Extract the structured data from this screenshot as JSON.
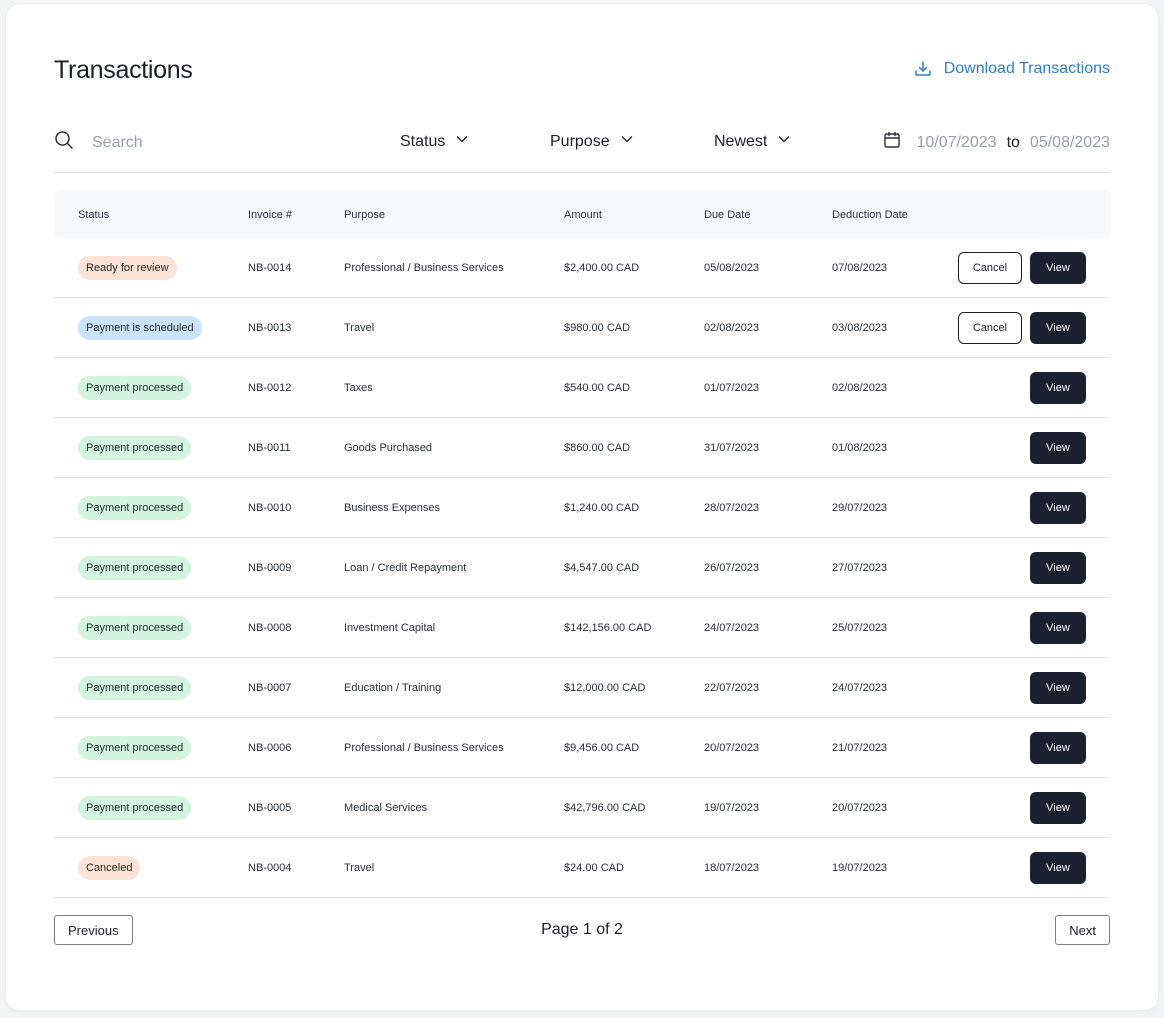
{
  "header": {
    "title": "Transactions",
    "download_label": "Download Transactions"
  },
  "filters": {
    "search_placeholder": "Search",
    "status_label": "Status",
    "purpose_label": "Purpose",
    "sort_label": "Newest",
    "date_from": "10/07/2023",
    "date_to_word": "to",
    "date_to": "05/08/2023"
  },
  "table": {
    "columns": [
      "Status",
      "Invoice #",
      "Purpose",
      "Amount",
      "Due Date",
      "Deduction Date"
    ],
    "rows": [
      {
        "status": "Ready for review",
        "invoice": "NB-0014",
        "purpose": "Professional / Business Services",
        "amount": "$2,400.00 CAD",
        "due": "05/08/2023",
        "deduction": "07/08/2023"
      },
      {
        "status": "Payment is scheduled",
        "invoice": "NB-0013",
        "purpose": "Travel",
        "amount": "$980.00 CAD",
        "due": "02/08/2023",
        "deduction": "03/08/2023"
      },
      {
        "status": "Payment processed",
        "invoice": "NB-0012",
        "purpose": "Taxes",
        "amount": "$540.00 CAD",
        "due": "01/07/2023",
        "deduction": "02/08/2023"
      },
      {
        "status": "Payment processed",
        "invoice": "NB-0011",
        "purpose": "Goods Purchased",
        "amount": "$860.00 CAD",
        "due": "31/07/2023",
        "deduction": "01/08/2023"
      },
      {
        "status": "Payment processed",
        "invoice": "NB-0010",
        "purpose": "Business Expenses",
        "amount": "$1,240.00 CAD",
        "due": "28/07/2023",
        "deduction": "29/07/2023"
      },
      {
        "status": "Payment processed",
        "invoice": "NB-0009",
        "purpose": "Loan / Credit Repayment",
        "amount": "$4,547.00 CAD",
        "due": "26/07/2023",
        "deduction": "27/07/2023"
      },
      {
        "status": "Payment processed",
        "invoice": "NB-0008",
        "purpose": "Investment Capital",
        "amount": "$142,156.00 CAD",
        "due": "24/07/2023",
        "deduction": "25/07/2023"
      },
      {
        "status": "Payment processed",
        "invoice": "NB-0007",
        "purpose": "Education / Training",
        "amount": "$12,000.00 CAD",
        "due": "22/07/2023",
        "deduction": "24/07/2023"
      },
      {
        "status": "Payment processed",
        "invoice": "NB-0006",
        "purpose": "Professional / Business Services",
        "amount": "$9,456.00 CAD",
        "due": "20/07/2023",
        "deduction": "21/07/2023"
      },
      {
        "status": "Payment processed",
        "invoice": "NB-0005",
        "purpose": "Medical Services",
        "amount": "$42,796.00 CAD",
        "due": "19/07/2023",
        "deduction": "20/07/2023"
      },
      {
        "status": "Canceled",
        "invoice": "NB-0004",
        "purpose": "Travel",
        "amount": "$24.00 CAD",
        "due": "18/07/2023",
        "deduction": "19/07/2023"
      }
    ],
    "view_label": "View",
    "cancel_label": "Cancel"
  },
  "pagination": {
    "previous_label": "Previous",
    "page_info": "Page 1 of 2",
    "next_label": "Next"
  },
  "colors": {
    "accent": "#2f80c8",
    "dark_button": "#1b2130",
    "badge_review": "#fde3d5",
    "badge_scheduled": "#cbe4fb",
    "badge_processed": "#d3f5df",
    "badge_canceled": "#fde3d5"
  },
  "icons": {
    "download": "download-icon",
    "search": "search-icon",
    "chevron": "chevron-down-icon",
    "calendar": "calendar-icon"
  }
}
